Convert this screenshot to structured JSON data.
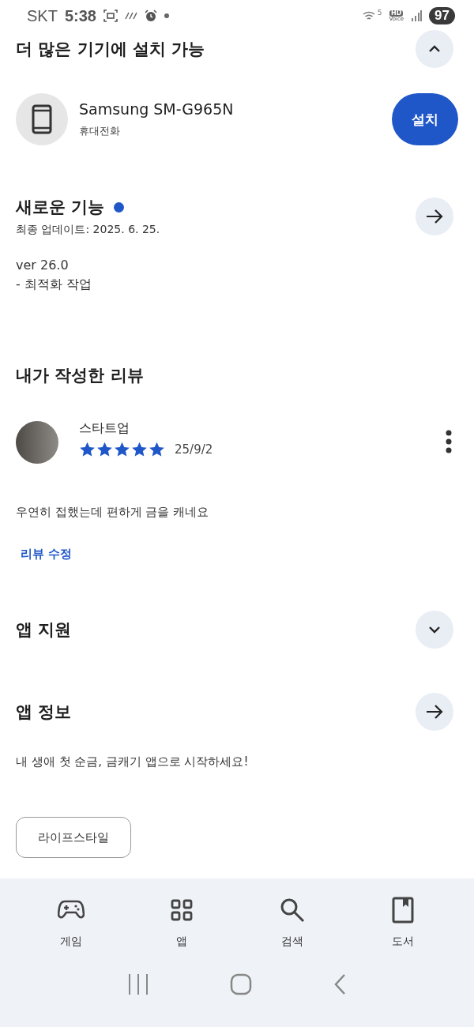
{
  "status_bar": {
    "carrier": "SKT",
    "time": "5:38",
    "network": "5",
    "hd": "HD",
    "voice": "Voice",
    "battery": "97"
  },
  "install_section": {
    "title": "더 많은 기기에 설치 가능",
    "expanded": true,
    "devices": [
      {
        "name": "Samsung SM-G965N",
        "type": "휴대전화",
        "button": "설치"
      }
    ]
  },
  "whats_new": {
    "title": "새로운 기능",
    "new_badge": true,
    "updated": "최종 업데이트: 2025. 6. 25.",
    "lines": [
      "ver 26.0",
      "- 최적화 작업"
    ]
  },
  "my_review": {
    "title": "내가 작성한 리뷰",
    "author": "스타트업",
    "stars": 5,
    "date": "25/9/2",
    "text": "우연히 접했는데 편하게 금을 캐네요",
    "edit_link": "리뷰 수정"
  },
  "app_support": {
    "title": "앱 지원",
    "expanded": false
  },
  "app_info": {
    "title": "앱 정보",
    "description": "내 생애 첫 순금, 금캐기 앱으로 시작하세요!",
    "category": "라이프스타일"
  },
  "bottom_nav": [
    {
      "kind": "games",
      "label": "게임"
    },
    {
      "kind": "apps",
      "label": "앱"
    },
    {
      "kind": "search",
      "label": "검색"
    },
    {
      "kind": "books",
      "label": "도서"
    }
  ]
}
